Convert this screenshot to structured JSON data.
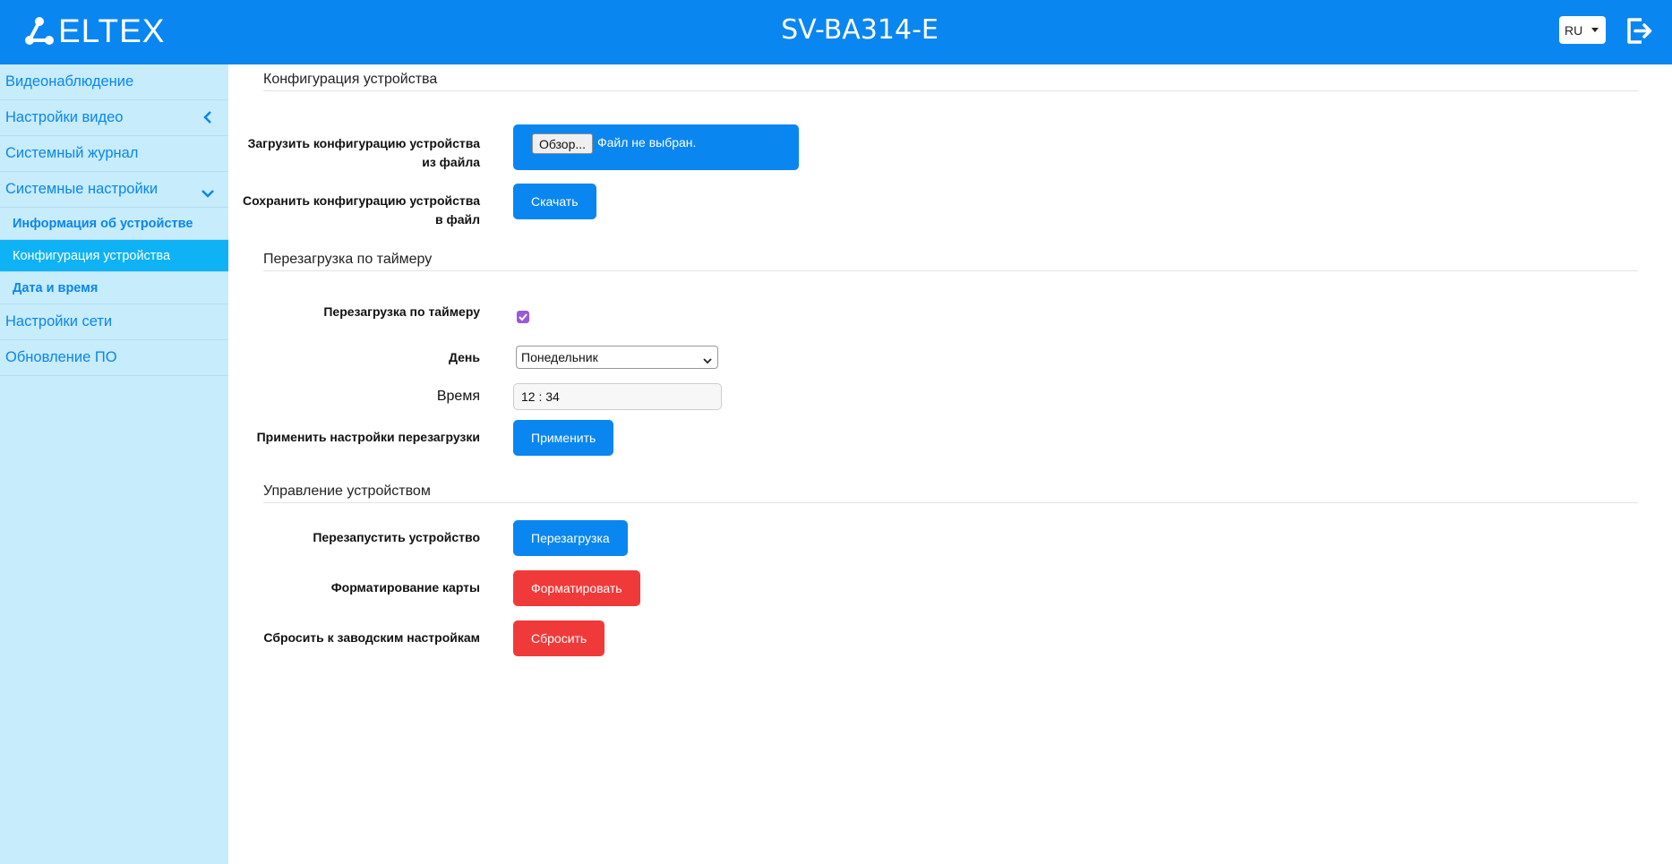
{
  "header": {
    "logo_text": "ELTEX",
    "device_title": "SV-BA314-E",
    "lang": "RU",
    "logout_icon": "logout-icon"
  },
  "sidebar": {
    "items": [
      {
        "label": "Видеонаблюдение"
      },
      {
        "label": "Настройки видео",
        "icon": "chevron-left-icon"
      },
      {
        "label": "Системный журнал"
      },
      {
        "label": "Системные настройки",
        "icon": "chevron-down-icon"
      },
      {
        "label": "Информация об устройстве"
      },
      {
        "label": "Конфигурация устройства",
        "active": true
      },
      {
        "label": "Дата и время"
      },
      {
        "label": "Настройки сети"
      },
      {
        "label": "Обновление ПО"
      }
    ]
  },
  "config": {
    "title": "Конфигурация устройства",
    "upload_label": "Загрузить конфигурацию устройства из файла",
    "browse_label": "Обзор...",
    "file_status": "Файл не выбран.",
    "save_label": "Сохранить конфигурацию устройства в файл",
    "download_button": "Скачать"
  },
  "timer": {
    "title": "Перезагрузка по таймеру",
    "enable_label": "Перезагрузка по таймеру",
    "enabled": true,
    "day_label": "День",
    "day_value": "Понедельник",
    "time_label": "Время",
    "time_value": "12 : 34",
    "apply_label": "Применить настройки перезагрузки",
    "apply_button": "Применить"
  },
  "control": {
    "title": "Управление устройством",
    "restart_label": "Перезапустить устройство",
    "restart_button": "Перезагрузка",
    "format_label": "Форматирование карты",
    "format_button": "Форматировать",
    "reset_label": "Сбросить к заводским настройкам",
    "reset_button": "Сбросить"
  },
  "colors": {
    "primary": "#0a86f0",
    "danger": "#f03a3a",
    "sidebar_bg": "#c7ecfb",
    "active_item": "#0fb3f5"
  }
}
